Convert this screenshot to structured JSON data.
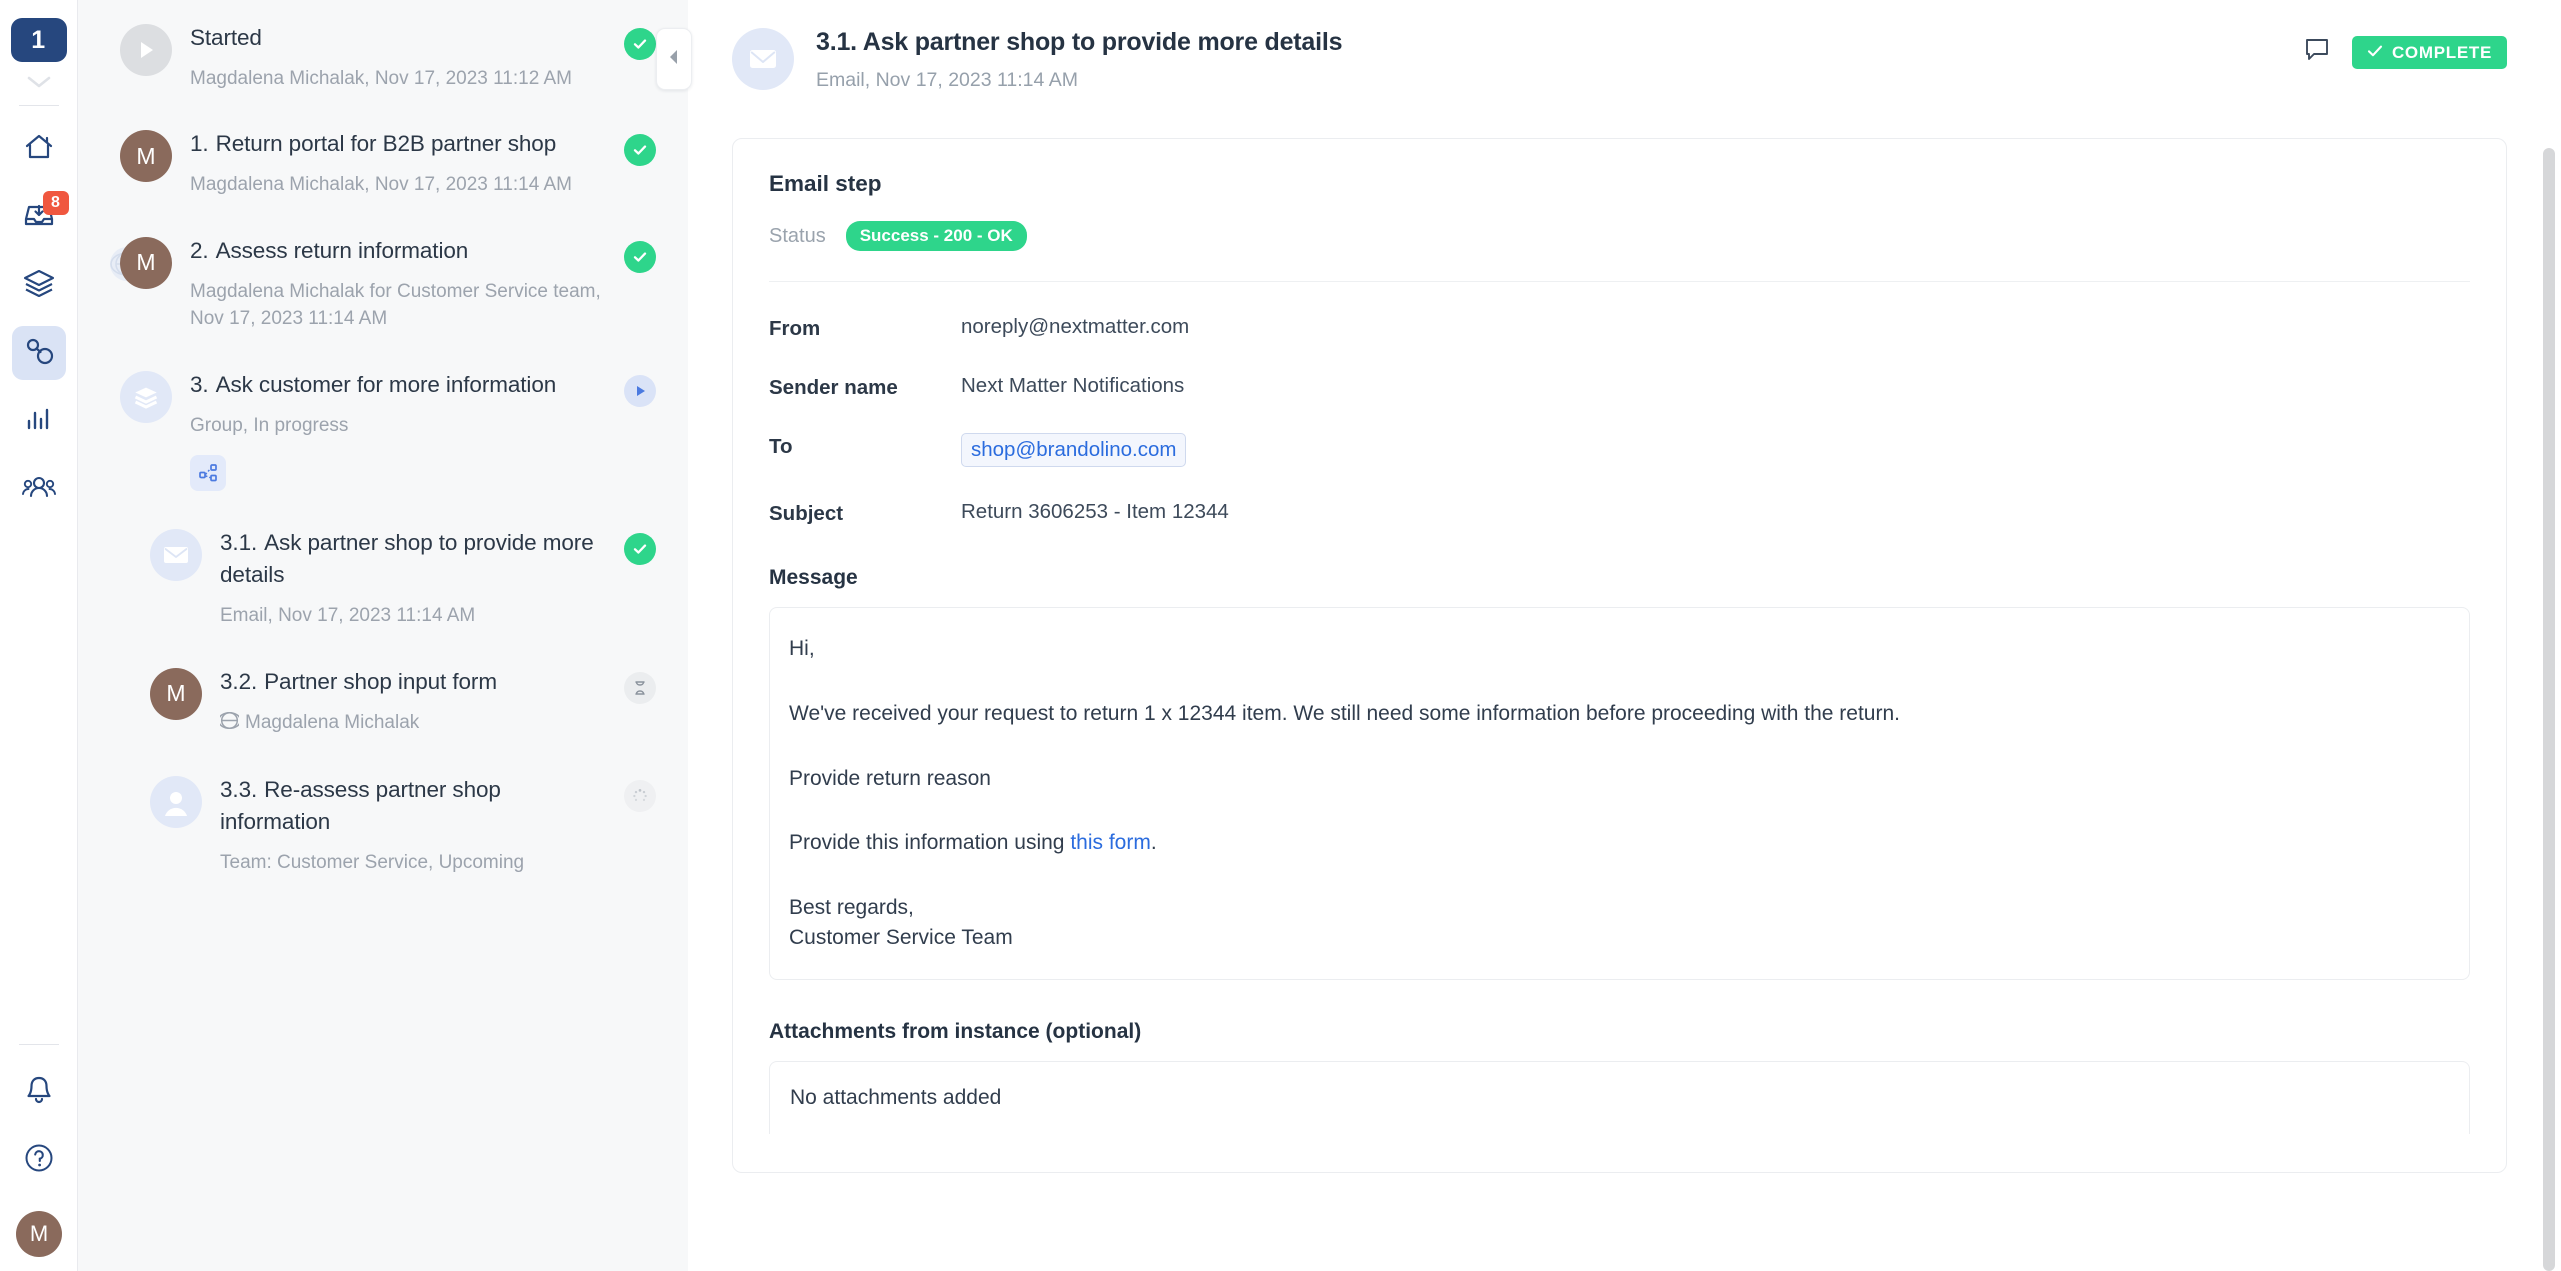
{
  "rail": {
    "org_badge": "1",
    "badge_count": "8",
    "items": [
      {
        "name": "home-icon",
        "label": "Home"
      },
      {
        "name": "inbox-icon",
        "label": "Inbox"
      },
      {
        "name": "layers-icon",
        "label": "Workflows"
      },
      {
        "name": "instances-icon",
        "label": "Instances"
      },
      {
        "name": "analytics-icon",
        "label": "Analytics"
      },
      {
        "name": "team-icon",
        "label": "Team"
      }
    ],
    "bottom": [
      {
        "name": "bell-icon",
        "label": "Notifications"
      },
      {
        "name": "help-icon",
        "label": "Help"
      }
    ],
    "user_initial": "M"
  },
  "tasklist": {
    "tasks": [
      {
        "num": "",
        "title": "Started",
        "meta": "Magdalena Michalak, Nov 17, 2023 11:12 AM",
        "icon": "play-circle-icon",
        "avatar": "",
        "status": "done",
        "sub": false,
        "globe": false,
        "subgroup": false
      },
      {
        "num": "1.",
        "title": "Return portal for B2B partner shop",
        "meta": "Magdalena Michalak, Nov 17, 2023 11:14 AM",
        "icon": "avatar-icon",
        "avatar": "M",
        "status": "done",
        "sub": false,
        "globe": false,
        "subgroup": false
      },
      {
        "num": "2.",
        "title": "Assess return information",
        "meta": "Magdalena Michalak for Customer Service team, Nov 17, 2023 11:14 AM",
        "icon": "avatar-icon",
        "avatar": "M",
        "status": "done",
        "sub": false,
        "globe": true,
        "subgroup": false
      },
      {
        "num": "3.",
        "title": "Ask customer for more information",
        "meta": "Group, In progress",
        "icon": "layers-circle-icon",
        "avatar": "",
        "status": "running",
        "sub": false,
        "globe": false,
        "subgroup": true
      },
      {
        "num": "3.1.",
        "title": "Ask partner shop to provide more details",
        "meta": "Email, Nov 17, 2023 11:14 AM",
        "icon": "envelope-circle-icon",
        "avatar": "",
        "status": "done",
        "sub": true,
        "globe": false,
        "subgroup": false
      },
      {
        "num": "3.2.",
        "title": "Partner shop input form",
        "meta": "Magdalena Michalak",
        "icon": "avatar-icon",
        "avatar": "M",
        "status": "waiting",
        "sub": true,
        "globe": true,
        "subgroup": false
      },
      {
        "num": "3.3.",
        "title": "Re-assess partner shop information",
        "meta": "Team: Customer Service, Upcoming",
        "icon": "person-circle-icon",
        "avatar": "",
        "status": "upcoming",
        "sub": true,
        "globe": false,
        "subgroup": false
      }
    ],
    "collapse_icon": "chevron-left-icon"
  },
  "detail": {
    "icon": "envelope-circle-icon",
    "title": "3.1. Ask partner shop to provide more details",
    "subtitle": "Email, Nov 17, 2023 11:14 AM",
    "comment_icon": "comment-icon",
    "complete_label": "COMPLETE",
    "card": {
      "title": "Email step",
      "status_label": "Status",
      "status_value": "Success - 200 - OK",
      "fields": [
        {
          "label": "From",
          "value": "noreply@nextmatter.com",
          "chip": false
        },
        {
          "label": "Sender name",
          "value": "Next Matter Notifications",
          "chip": false
        },
        {
          "label": "To",
          "value": "shop@brandolino.com",
          "chip": true
        },
        {
          "label": "Subject",
          "value": "Return 3606253 - Item 12344",
          "chip": false
        }
      ],
      "message_label": "Message",
      "message": {
        "greeting": "Hi,",
        "paragraph1": "We've received your request to return 1 x 12344 item. We still need some information before proceeding with the return.",
        "paragraph2": "Provide return reason",
        "paragraph3_pre": "Provide this information using ",
        "paragraph3_link": "this form",
        "paragraph3_post": ".",
        "signoff_line1": "Best regards,",
        "signoff_line2": "Customer Service Team"
      },
      "attachments_label": "Attachments from instance (optional)",
      "attachments_empty": "No attachments added"
    }
  },
  "colors": {
    "brand_navy": "#26477e",
    "success_green": "#2ed58b",
    "badge_red": "#f0573f",
    "link_blue": "#2b6cde",
    "avatar_brown": "#8a6a5c"
  }
}
